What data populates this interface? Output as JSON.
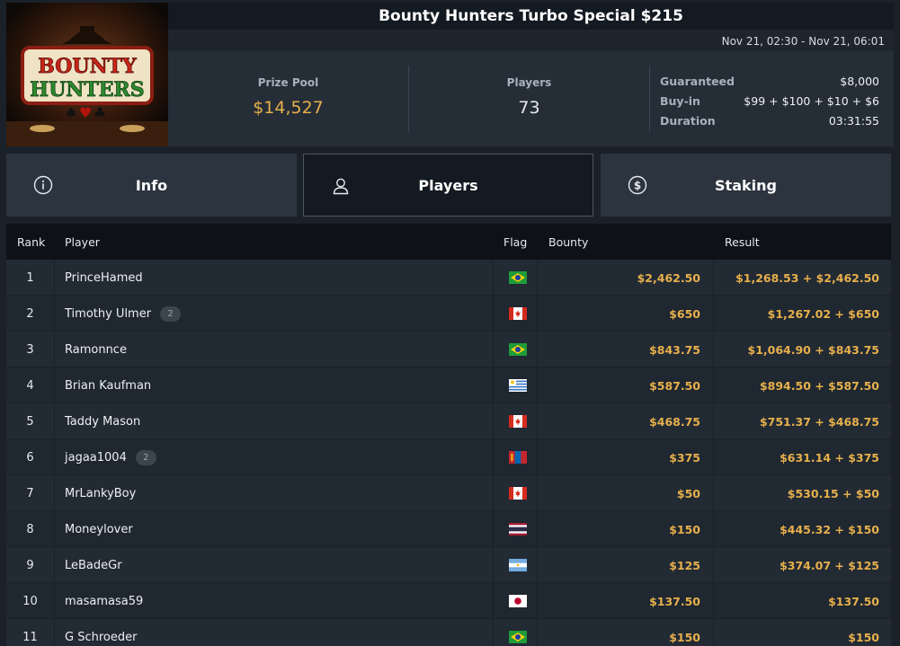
{
  "header": {
    "title": "Bounty Hunters Turbo Special $215",
    "dates": "Nov 21, 02:30 - Nov 21, 06:01",
    "logo_text": [
      "BOUNTY",
      "HUNTERS"
    ]
  },
  "stats": {
    "prize_pool_label": "Prize Pool",
    "prize_pool_value": "$14,527",
    "players_label": "Players",
    "players_value": "73",
    "guaranteed_label": "Guaranteed",
    "guaranteed_value": "$8,000",
    "buyin_label": "Buy-in",
    "buyin_value": "$99 + $100 + $10 + $6",
    "duration_label": "Duration",
    "duration_value": "03:31:55"
  },
  "tabs": {
    "info": "Info",
    "players": "Players",
    "staking": "Staking"
  },
  "table": {
    "headers": {
      "rank": "Rank",
      "player": "Player",
      "flag": "Flag",
      "bounty": "Bounty",
      "result": "Result"
    },
    "rows": [
      {
        "rank": "1",
        "player": "PrinceHamed",
        "badge": "",
        "flag": "brazil",
        "bounty": "$2,462.50",
        "result": "$1,268.53 + $2,462.50"
      },
      {
        "rank": "2",
        "player": "Timothy Ulmer",
        "badge": "2",
        "flag": "canada",
        "bounty": "$650",
        "result": "$1,267.02 + $650"
      },
      {
        "rank": "3",
        "player": "Ramonnce",
        "badge": "",
        "flag": "brazil",
        "bounty": "$843.75",
        "result": "$1,064.90 + $843.75"
      },
      {
        "rank": "4",
        "player": "Brian Kaufman",
        "badge": "",
        "flag": "uruguay",
        "bounty": "$587.50",
        "result": "$894.50 + $587.50"
      },
      {
        "rank": "5",
        "player": "Taddy Mason",
        "badge": "",
        "flag": "canada",
        "bounty": "$468.75",
        "result": "$751.37 + $468.75"
      },
      {
        "rank": "6",
        "player": "jagaa1004",
        "badge": "2",
        "flag": "mongolia",
        "bounty": "$375",
        "result": "$631.14 + $375"
      },
      {
        "rank": "7",
        "player": "MrLankyBoy",
        "badge": "",
        "flag": "canada",
        "bounty": "$50",
        "result": "$530.15 + $50"
      },
      {
        "rank": "8",
        "player": "Moneylover",
        "badge": "",
        "flag": "thailand",
        "bounty": "$150",
        "result": "$445.32 + $150"
      },
      {
        "rank": "9",
        "player": "LeBadeGr",
        "badge": "",
        "flag": "argentina",
        "bounty": "$125",
        "result": "$374.07 + $125"
      },
      {
        "rank": "10",
        "player": "masamasa59",
        "badge": "",
        "flag": "japan",
        "bounty": "$137.50",
        "result": "$137.50"
      },
      {
        "rank": "11",
        "player": "G Schroeder",
        "badge": "",
        "flag": "brazil",
        "bounty": "$150",
        "result": "$150"
      }
    ]
  },
  "colors": {
    "gold": "#e7b04c",
    "background": "#1b2129",
    "header_dark": "#141a21",
    "tab_bg": "#2b343f"
  }
}
